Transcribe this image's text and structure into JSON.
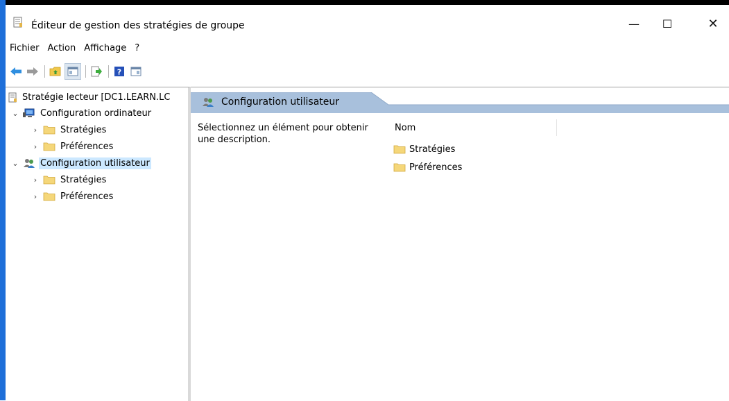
{
  "window": {
    "title": "Éditeur de gestion des stratégies de groupe",
    "minimize_glyph": "—",
    "maximize_glyph": "☐",
    "close_glyph": "✕"
  },
  "menu": [
    "Fichier",
    "Action",
    "Affichage",
    "?"
  ],
  "toolbar_icons": [
    "back-arrow-icon",
    "forward-arrow-icon",
    "up-folder-icon",
    "show-hide-tree-icon",
    "export-list-icon",
    "help-icon",
    "properties-icon"
  ],
  "tree": {
    "root": "Stratégie lecteur [DC1.LEARN.LC",
    "computer_config": "Configuration ordinateur",
    "cc_policies": "Stratégies",
    "cc_preferences": "Préférences",
    "user_config": "Configuration utilisateur",
    "uc_policies": "Stratégies",
    "uc_preferences": "Préférences"
  },
  "content": {
    "header": "Configuration utilisateur",
    "description": "Sélectionnez un élément pour obtenir une description.",
    "column_name": "Nom",
    "items": [
      "Stratégies",
      "Préférences"
    ]
  },
  "colors": {
    "header_band": "#a8c0dc",
    "selection": "#cce8ff",
    "folder": "#f5d77a",
    "accent_strip": "#1e6fd9"
  }
}
